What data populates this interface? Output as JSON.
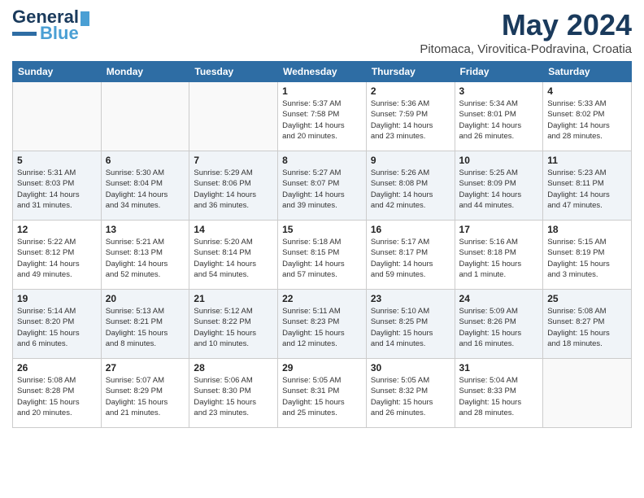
{
  "header": {
    "logo_line1": "General",
    "logo_line2": "Blue",
    "month_title": "May 2024",
    "subtitle": "Pitomaca, Virovitica-Podravina, Croatia"
  },
  "weekdays": [
    "Sunday",
    "Monday",
    "Tuesday",
    "Wednesday",
    "Thursday",
    "Friday",
    "Saturday"
  ],
  "weeks": [
    [
      {
        "day": "",
        "info": ""
      },
      {
        "day": "",
        "info": ""
      },
      {
        "day": "",
        "info": ""
      },
      {
        "day": "1",
        "info": "Sunrise: 5:37 AM\nSunset: 7:58 PM\nDaylight: 14 hours\nand 20 minutes."
      },
      {
        "day": "2",
        "info": "Sunrise: 5:36 AM\nSunset: 7:59 PM\nDaylight: 14 hours\nand 23 minutes."
      },
      {
        "day": "3",
        "info": "Sunrise: 5:34 AM\nSunset: 8:01 PM\nDaylight: 14 hours\nand 26 minutes."
      },
      {
        "day": "4",
        "info": "Sunrise: 5:33 AM\nSunset: 8:02 PM\nDaylight: 14 hours\nand 28 minutes."
      }
    ],
    [
      {
        "day": "5",
        "info": "Sunrise: 5:31 AM\nSunset: 8:03 PM\nDaylight: 14 hours\nand 31 minutes."
      },
      {
        "day": "6",
        "info": "Sunrise: 5:30 AM\nSunset: 8:04 PM\nDaylight: 14 hours\nand 34 minutes."
      },
      {
        "day": "7",
        "info": "Sunrise: 5:29 AM\nSunset: 8:06 PM\nDaylight: 14 hours\nand 36 minutes."
      },
      {
        "day": "8",
        "info": "Sunrise: 5:27 AM\nSunset: 8:07 PM\nDaylight: 14 hours\nand 39 minutes."
      },
      {
        "day": "9",
        "info": "Sunrise: 5:26 AM\nSunset: 8:08 PM\nDaylight: 14 hours\nand 42 minutes."
      },
      {
        "day": "10",
        "info": "Sunrise: 5:25 AM\nSunset: 8:09 PM\nDaylight: 14 hours\nand 44 minutes."
      },
      {
        "day": "11",
        "info": "Sunrise: 5:23 AM\nSunset: 8:11 PM\nDaylight: 14 hours\nand 47 minutes."
      }
    ],
    [
      {
        "day": "12",
        "info": "Sunrise: 5:22 AM\nSunset: 8:12 PM\nDaylight: 14 hours\nand 49 minutes."
      },
      {
        "day": "13",
        "info": "Sunrise: 5:21 AM\nSunset: 8:13 PM\nDaylight: 14 hours\nand 52 minutes."
      },
      {
        "day": "14",
        "info": "Sunrise: 5:20 AM\nSunset: 8:14 PM\nDaylight: 14 hours\nand 54 minutes."
      },
      {
        "day": "15",
        "info": "Sunrise: 5:18 AM\nSunset: 8:15 PM\nDaylight: 14 hours\nand 57 minutes."
      },
      {
        "day": "16",
        "info": "Sunrise: 5:17 AM\nSunset: 8:17 PM\nDaylight: 14 hours\nand 59 minutes."
      },
      {
        "day": "17",
        "info": "Sunrise: 5:16 AM\nSunset: 8:18 PM\nDaylight: 15 hours\nand 1 minute."
      },
      {
        "day": "18",
        "info": "Sunrise: 5:15 AM\nSunset: 8:19 PM\nDaylight: 15 hours\nand 3 minutes."
      }
    ],
    [
      {
        "day": "19",
        "info": "Sunrise: 5:14 AM\nSunset: 8:20 PM\nDaylight: 15 hours\nand 6 minutes."
      },
      {
        "day": "20",
        "info": "Sunrise: 5:13 AM\nSunset: 8:21 PM\nDaylight: 15 hours\nand 8 minutes."
      },
      {
        "day": "21",
        "info": "Sunrise: 5:12 AM\nSunset: 8:22 PM\nDaylight: 15 hours\nand 10 minutes."
      },
      {
        "day": "22",
        "info": "Sunrise: 5:11 AM\nSunset: 8:23 PM\nDaylight: 15 hours\nand 12 minutes."
      },
      {
        "day": "23",
        "info": "Sunrise: 5:10 AM\nSunset: 8:25 PM\nDaylight: 15 hours\nand 14 minutes."
      },
      {
        "day": "24",
        "info": "Sunrise: 5:09 AM\nSunset: 8:26 PM\nDaylight: 15 hours\nand 16 minutes."
      },
      {
        "day": "25",
        "info": "Sunrise: 5:08 AM\nSunset: 8:27 PM\nDaylight: 15 hours\nand 18 minutes."
      }
    ],
    [
      {
        "day": "26",
        "info": "Sunrise: 5:08 AM\nSunset: 8:28 PM\nDaylight: 15 hours\nand 20 minutes."
      },
      {
        "day": "27",
        "info": "Sunrise: 5:07 AM\nSunset: 8:29 PM\nDaylight: 15 hours\nand 21 minutes."
      },
      {
        "day": "28",
        "info": "Sunrise: 5:06 AM\nSunset: 8:30 PM\nDaylight: 15 hours\nand 23 minutes."
      },
      {
        "day": "29",
        "info": "Sunrise: 5:05 AM\nSunset: 8:31 PM\nDaylight: 15 hours\nand 25 minutes."
      },
      {
        "day": "30",
        "info": "Sunrise: 5:05 AM\nSunset: 8:32 PM\nDaylight: 15 hours\nand 26 minutes."
      },
      {
        "day": "31",
        "info": "Sunrise: 5:04 AM\nSunset: 8:33 PM\nDaylight: 15 hours\nand 28 minutes."
      },
      {
        "day": "",
        "info": ""
      }
    ]
  ]
}
